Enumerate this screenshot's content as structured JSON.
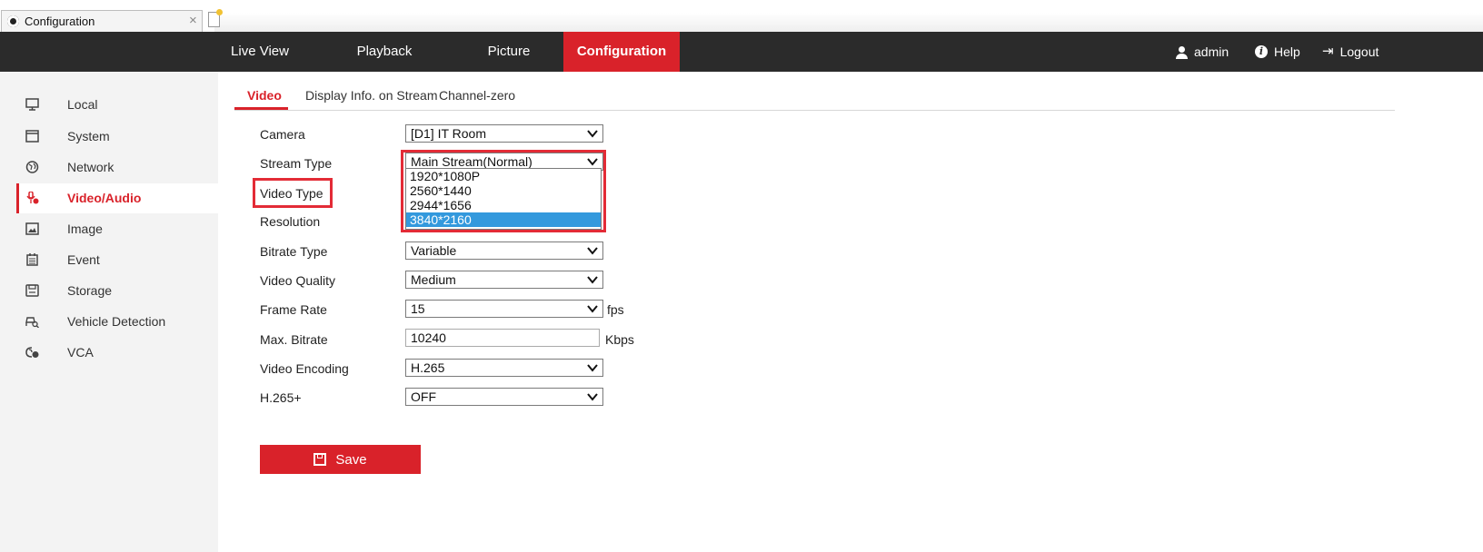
{
  "browser": {
    "tab_title": "Configuration",
    "close_glyph": "×"
  },
  "topnav": {
    "items": [
      "Live View",
      "Playback",
      "Picture",
      "Configuration"
    ],
    "active": "Configuration",
    "user": "admin",
    "help": "Help",
    "logout": "Logout",
    "accent_color": "#d9222a",
    "bar_color": "#2b2b2b"
  },
  "sidebar": {
    "items": [
      {
        "label": "Local",
        "icon": "monitor-icon"
      },
      {
        "label": "System",
        "icon": "window-icon"
      },
      {
        "label": "Network",
        "icon": "globe-icon"
      },
      {
        "label": "Video/Audio",
        "icon": "video-audio-icon"
      },
      {
        "label": "Image",
        "icon": "image-icon"
      },
      {
        "label": "Event",
        "icon": "calendar-icon"
      },
      {
        "label": "Storage",
        "icon": "storage-icon"
      },
      {
        "label": "Vehicle Detection",
        "icon": "vehicle-detection-icon"
      },
      {
        "label": "VCA",
        "icon": "vca-icon"
      }
    ],
    "active": "Video/Audio"
  },
  "subtabs": {
    "items": [
      "Video",
      "Display Info. on Stream",
      "Channel-zero"
    ],
    "active": "Video"
  },
  "form": {
    "camera": {
      "label": "Camera",
      "value": "[D1] IT Room"
    },
    "stream_type": {
      "label": "Stream Type",
      "value": "Main Stream(Normal)"
    },
    "video_type": {
      "label": "Video Type"
    },
    "resolution": {
      "label": "Resolution",
      "options": [
        "1920*1080P",
        "2560*1440",
        "2944*1656",
        "3840*2160"
      ],
      "selected": "3840*2160"
    },
    "bitrate_type": {
      "label": "Bitrate Type",
      "value": "Variable"
    },
    "video_quality": {
      "label": "Video Quality",
      "value": "Medium"
    },
    "frame_rate": {
      "label": "Frame Rate",
      "value": "15",
      "unit": "fps"
    },
    "max_bitrate": {
      "label": "Max. Bitrate",
      "value": "10240",
      "unit": "Kbps"
    },
    "video_encoding": {
      "label": "Video Encoding",
      "value": "H.265"
    },
    "h265plus": {
      "label": "H.265+",
      "value": "OFF"
    }
  },
  "save_label": "Save",
  "highlight_color": "#e32b36",
  "selected_option_color": "#3399dd"
}
